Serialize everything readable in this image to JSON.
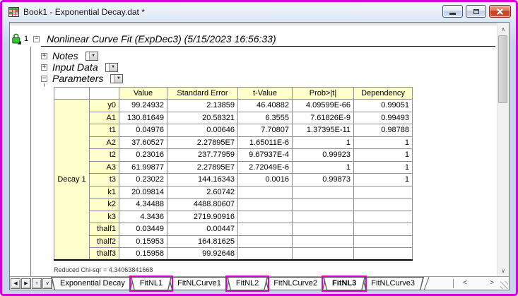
{
  "colors": {
    "accent": "#d400d4",
    "tableyellow": "#ffffcc"
  },
  "window": {
    "title": "Book1 - Exponential Decay.dat *"
  },
  "report": {
    "row_number": "1",
    "title": "Nonlinear Curve Fit (ExpDec3) (5/15/2023 16:56:33)",
    "sections": [
      {
        "label": "Notes",
        "state": "collapsed"
      },
      {
        "label": "Input Data",
        "state": "collapsed"
      },
      {
        "label": "Parameters",
        "state": "expanded"
      }
    ],
    "footnote": "Reduced Chi-sqr = 4.34063841668"
  },
  "parameters_table": {
    "group_label": "Decay 1",
    "columns": [
      "Value",
      "Standard Error",
      "t-Value",
      "Prob>|t|",
      "Dependency"
    ],
    "rows": [
      {
        "param": "y0",
        "value": "99.24932",
        "std_error": "2.13859",
        "t_value": "46.40882",
        "prob": "4.09599E-66",
        "dependency": "0.99051"
      },
      {
        "param": "A1",
        "value": "130.81649",
        "std_error": "20.58321",
        "t_value": "6.3555",
        "prob": "7.61826E-9",
        "dependency": "0.99493"
      },
      {
        "param": "t1",
        "value": "0.04976",
        "std_error": "0.00646",
        "t_value": "7.70807",
        "prob": "1.37395E-11",
        "dependency": "0.98788"
      },
      {
        "param": "A2",
        "value": "37.60527",
        "std_error": "2.27895E7",
        "t_value": "1.65011E-6",
        "prob": "1",
        "dependency": "1"
      },
      {
        "param": "t2",
        "value": "0.23016",
        "std_error": "237.77959",
        "t_value": "9.67937E-4",
        "prob": "0.99923",
        "dependency": "1"
      },
      {
        "param": "A3",
        "value": "61.99877",
        "std_error": "2.27895E7",
        "t_value": "2.72049E-6",
        "prob": "1",
        "dependency": "1"
      },
      {
        "param": "t3",
        "value": "0.23022",
        "std_error": "144.16343",
        "t_value": "0.0016",
        "prob": "0.99873",
        "dependency": "1"
      },
      {
        "param": "k1",
        "value": "20.09814",
        "std_error": "2.60742",
        "t_value": "",
        "prob": "",
        "dependency": ""
      },
      {
        "param": "k2",
        "value": "4.34488",
        "std_error": "4488.80607",
        "t_value": "",
        "prob": "",
        "dependency": ""
      },
      {
        "param": "k3",
        "value": "4.3436",
        "std_error": "2719.90916",
        "t_value": "",
        "prob": "",
        "dependency": ""
      },
      {
        "param": "thalf1",
        "value": "0.03449",
        "std_error": "0.00447",
        "t_value": "",
        "prob": "",
        "dependency": ""
      },
      {
        "param": "thalf2",
        "value": "0.15953",
        "std_error": "164.81625",
        "t_value": "",
        "prob": "",
        "dependency": ""
      },
      {
        "param": "thalf3",
        "value": "0.15958",
        "std_error": "99.92648",
        "t_value": "",
        "prob": "",
        "dependency": ""
      }
    ]
  },
  "tab_bar": {
    "nav": [
      {
        "name": "tab-prev",
        "glyph": "◀"
      },
      {
        "name": "tab-next",
        "glyph": "▶"
      },
      {
        "name": "add-sheet",
        "glyph": "+"
      },
      {
        "name": "sheet-list",
        "glyph": "∨"
      }
    ],
    "tabs": [
      {
        "label": "Exponential Decay",
        "active": false,
        "highlighted": false
      },
      {
        "label": "FitNL1",
        "active": false,
        "highlighted": true
      },
      {
        "label": "FitNLCurve1",
        "active": false,
        "highlighted": false
      },
      {
        "label": "FitNL2",
        "active": false,
        "highlighted": true
      },
      {
        "label": "FitNLCurve2",
        "active": false,
        "highlighted": false
      },
      {
        "label": "FitNL3",
        "active": true,
        "highlighted": true
      },
      {
        "label": "FitNLCurve3",
        "active": false,
        "highlighted": false
      }
    ],
    "scroll_left": "<",
    "scroll_right": ">"
  },
  "icons": {
    "combo_arrow": "▼",
    "collapsed": "+",
    "expanded": "−",
    "scroll_up": "∧",
    "scroll_down": "∨"
  }
}
